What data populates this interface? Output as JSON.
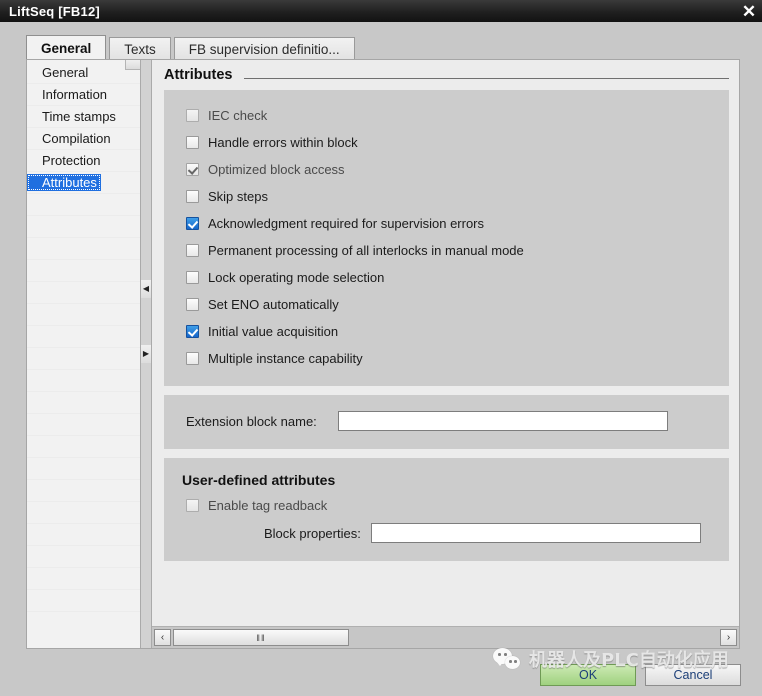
{
  "window": {
    "title": "LiftSeq [FB12]",
    "close_label": "✕"
  },
  "tabs": [
    {
      "label": "General",
      "active": true
    },
    {
      "label": "Texts",
      "active": false
    },
    {
      "label": "FB supervision definitio...",
      "active": false
    }
  ],
  "sidebar": {
    "items": [
      {
        "label": "General",
        "selected": false
      },
      {
        "label": "Information",
        "selected": false
      },
      {
        "label": "Time stamps",
        "selected": false
      },
      {
        "label": "Compilation",
        "selected": false
      },
      {
        "label": "Protection",
        "selected": false
      },
      {
        "label": "Attributes",
        "selected": true
      }
    ]
  },
  "splitter": {
    "up_glyph": "◀",
    "down_glyph": "▶"
  },
  "page": {
    "header_title": "Attributes",
    "checkboxes": [
      {
        "label": "IEC check",
        "checked": false,
        "disabled": true
      },
      {
        "label": "Handle errors within block",
        "checked": false,
        "disabled": false
      },
      {
        "label": "Optimized block access",
        "checked": true,
        "disabled": true
      },
      {
        "label": "Skip steps",
        "checked": false,
        "disabled": false
      },
      {
        "label": "Acknowledgment required for supervision errors",
        "checked": true,
        "disabled": false
      },
      {
        "label": "Permanent processing of all interlocks in manual mode",
        "checked": false,
        "disabled": false
      },
      {
        "label": "Lock operating mode selection",
        "checked": false,
        "disabled": false
      },
      {
        "label": "Set ENO automatically",
        "checked": false,
        "disabled": false
      },
      {
        "label": "Initial value acquisition",
        "checked": true,
        "disabled": false
      },
      {
        "label": "Multiple instance capability",
        "checked": false,
        "disabled": false
      }
    ],
    "extension_block": {
      "label": "Extension block name:",
      "value": "",
      "placeholder": ""
    },
    "user_defined": {
      "title": "User-defined attributes",
      "enable_tag_readback": {
        "label": "Enable tag readback",
        "checked": false,
        "disabled": true
      },
      "block_properties": {
        "label": "Block properties:",
        "value": "",
        "placeholder": ""
      }
    }
  },
  "hscrollbar": {
    "left_glyph": "‹",
    "right_glyph": "›",
    "grip": "‖‖"
  },
  "footer": {
    "ok_label": "OK",
    "cancel_label": "Cancel"
  },
  "watermark": {
    "text": "机器人及PLC自动化应用"
  },
  "colors": {
    "titlebar": "#202020",
    "selection_blue": "#1f6fe0",
    "checkbox_blue": "#1565c9",
    "ok_green": "#9fd17f",
    "panel_gray": "#cccccc",
    "page_gray": "#ececec"
  }
}
